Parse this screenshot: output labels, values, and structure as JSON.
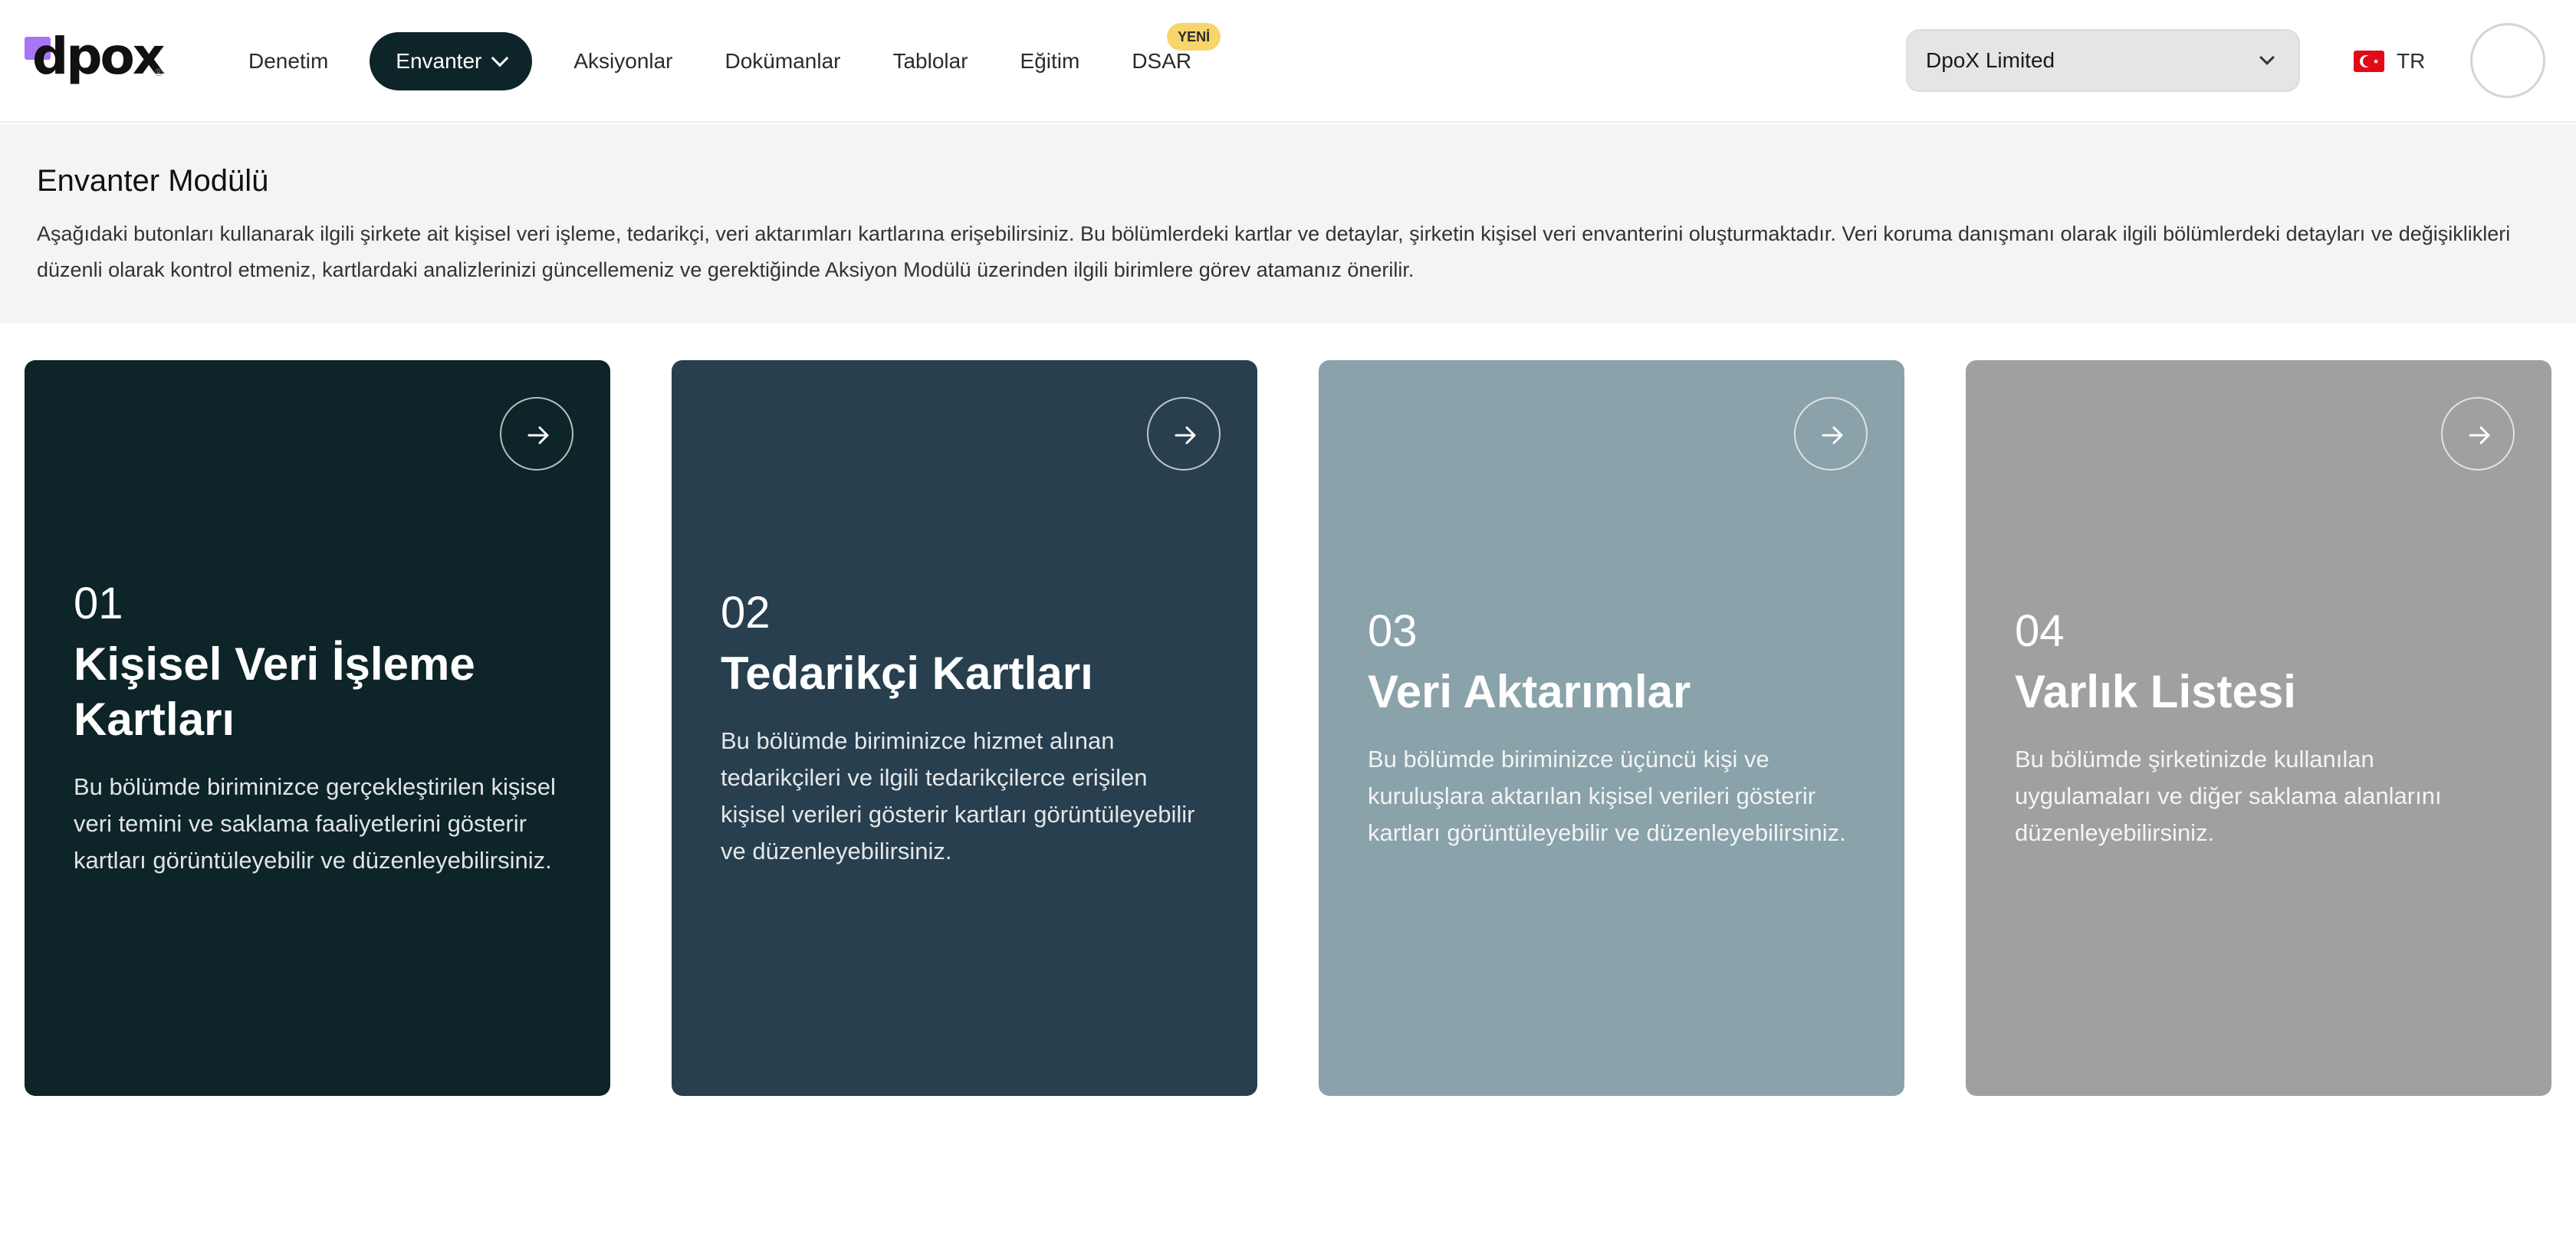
{
  "brand": {
    "logo_text": "dpox",
    "logo_mark": "®"
  },
  "nav": {
    "items": [
      {
        "label": "Denetim"
      },
      {
        "label": "Envanter",
        "active": true
      },
      {
        "label": "Aksiyonlar"
      },
      {
        "label": "Dokümanlar"
      },
      {
        "label": "Tablolar"
      },
      {
        "label": "Eğitim"
      },
      {
        "label": "DSAR",
        "badge": "YENİ"
      }
    ]
  },
  "company_select": {
    "value": "DpoX Limited"
  },
  "language": {
    "code": "TR",
    "flag_icon": "turkey-flag-icon"
  },
  "intro": {
    "title": "Envanter Modülü",
    "text": "Aşağıdaki butonları kullanarak ilgili şirkete ait kişisel veri işleme, tedarikçi, veri aktarımları kartlarına erişebilirsiniz. Bu bölümlerdeki kartlar ve detaylar, şirketin kişisel veri envanterini oluşturmaktadır. Veri koruma danışmanı olarak ilgili bölümlerdeki detayları ve değişiklikleri düzenli olarak kontrol etmeniz, kartlardaki analizlerinizi güncellemeniz ve gerektiğinde Aksiyon Modülü üzerinden ilgili birimlere görev atamanız önerilir."
  },
  "cards": [
    {
      "number": "01",
      "title": "Kişisel Veri İşleme Kartları",
      "description": "Bu bölümde biriminizce gerçekleştirilen kişisel veri temini ve saklama faaliyetlerini gösterir kartları görüntüleyebilir ve düzenleyebilirsiniz.",
      "color": "#0d2428"
    },
    {
      "number": "02",
      "title": "Tedarikçi Kartları",
      "description": "Bu bölümde biriminizce hizmet alınan tedarikçileri ve ilgili tedarikçilerce erişilen kişisel verileri gösterir kartları görüntüleyebilir ve düzenleyebilirsiniz.",
      "color": "#273f4f"
    },
    {
      "number": "03",
      "title": "Veri Aktarımlar",
      "description": "Bu bölümde biriminizce üçüncü kişi ve kuruluşlara aktarılan kişisel verileri gösterir kartları görüntüleyebilir ve düzenleyebilirsiniz.",
      "color": "#8aa2a9"
    },
    {
      "number": "04",
      "title": "Varlık Listesi",
      "description": "Bu bölümde şirketinizde kullanılan uygulamaları ve diğer saklama alanlarını düzenleyebilirsiniz.",
      "color": "#a0a0a0"
    }
  ]
}
